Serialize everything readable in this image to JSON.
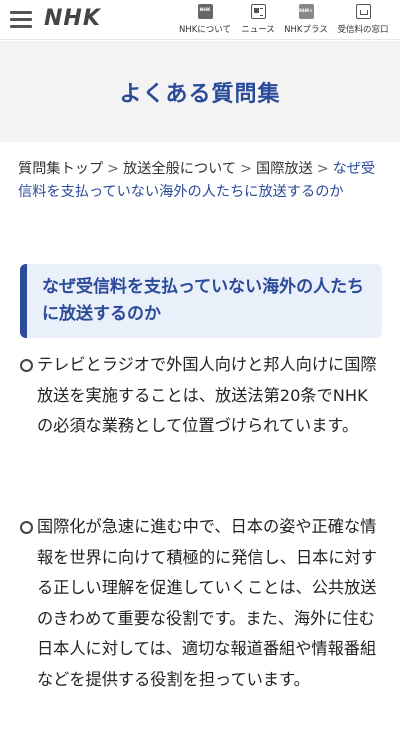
{
  "header": {
    "logo": "NHK",
    "nav": [
      {
        "label": "NHKについて",
        "icon": "nhk-logo-icon"
      },
      {
        "label": "ニュース",
        "icon": "newspaper-icon"
      },
      {
        "label": "NHKプラス",
        "icon": "nhk-plus-icon"
      },
      {
        "label": "受信料の窓口",
        "icon": "window-icon"
      }
    ]
  },
  "page": {
    "title": "よくある質問集"
  },
  "breadcrumb": {
    "items": [
      "質問集トップ",
      "放送全般について",
      "国際放送"
    ],
    "separator": ">",
    "current": "なぜ受信料を支払っていない海外の人たちに放送するのか"
  },
  "question": {
    "text": "なぜ受信料を支払っていない海外の人たちに放送するのか"
  },
  "answers": [
    "テレビとラジオで外国人向けと邦人向けに国際放送を実施することは、放送法第20条でNHKの必須な業務として位置づけられています。",
    "国際化が急速に進む中で、日本の姿や正確な情報を世界に向けて積極的に発信し、日本に対する正しい理解を促進していくことは、公共放送のきわめて重要な役割です。また、海外に住む日本人に対しては、適切な報道番組や情報番組などを提供する役割を担っています。"
  ],
  "colors": {
    "accent": "#2b4a9a",
    "question_bg": "#eaf0fa",
    "title_band": "#f3f3f3"
  }
}
